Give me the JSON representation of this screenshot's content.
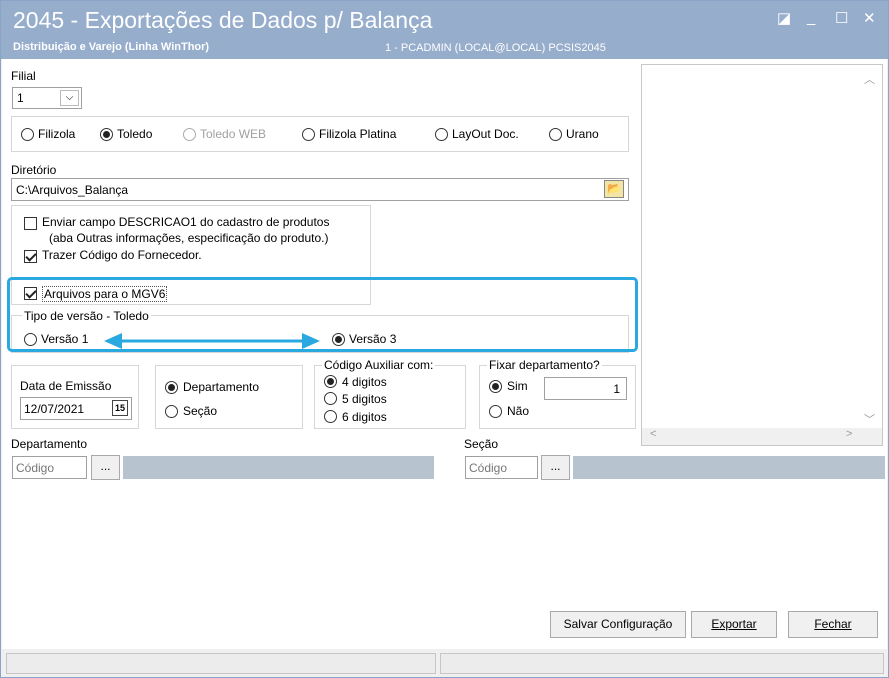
{
  "window": {
    "title": "2045 - Exportações de Dados p/ Balança",
    "subtitle": "Distribuição e Varejo (Linha WinThor)",
    "user_info": "1 - PCADMIN (LOCAL@LOCAL)   PCSIS2045"
  },
  "filial": {
    "label": "Filial",
    "value": "1"
  },
  "balanca": {
    "options": [
      "Filizola",
      "Toledo",
      "Toledo WEB",
      "Filizola Platina",
      "LayOut Doc.",
      "Urano"
    ],
    "selected": "Toledo"
  },
  "diretorio": {
    "label": "Diretório",
    "value": "C:\\Arquivos_Balança"
  },
  "checks": {
    "enviar_descricao_line1": "Enviar campo DESCRICAO1 do cadastro de produtos",
    "enviar_descricao_line2": "(aba Outras informações, especificação do produto.)",
    "trazer_codigo": "Trazer Código do Fornecedor.",
    "arquivos_mgv6": "Arquivos para o MGV6",
    "enviar_descricao_checked": false,
    "trazer_codigo_checked": true,
    "arquivos_mgv6_checked": true
  },
  "tipo_versao": {
    "label": "Tipo de versão - Toledo",
    "versao1": "Versão 1",
    "versao3": "Versão 3",
    "selected": "Versão 3"
  },
  "data_emissao": {
    "label": "Data de Emissão",
    "value": "12/07/2021",
    "calendar_icon": "15"
  },
  "agrupamento": {
    "options": [
      "Departamento",
      "Seção"
    ],
    "selected": "Departamento"
  },
  "codigo_auxiliar": {
    "label": "Código Auxiliar com:",
    "options": [
      "4 digitos",
      "5 digitos",
      "6 digitos"
    ],
    "selected": "4 digitos"
  },
  "fixar_departamento": {
    "label": "Fixar departamento?",
    "sim": "Sim",
    "nao": "Não",
    "selected": "Sim",
    "value": "1"
  },
  "departamento": {
    "label": "Departamento",
    "placeholder": "Código",
    "button": "..."
  },
  "secao": {
    "label": "Seção",
    "placeholder": "Código",
    "button": "..."
  },
  "buttons": {
    "salvar": "Salvar Configuração",
    "exportar": "Exportar",
    "fechar": "Fechar"
  },
  "colors": {
    "titlebar": "#96adcc",
    "highlight": "#2aa8e0",
    "lookup_field": "#b7c3ce"
  },
  "icons": [
    "restore-icon",
    "minimize-icon",
    "maximize-icon",
    "close-icon",
    "folder-open-icon",
    "calendar-icon",
    "chevron-down-icon",
    "scroll-up-icon",
    "scroll-down-icon",
    "scroll-left-icon",
    "scroll-right-icon"
  ]
}
